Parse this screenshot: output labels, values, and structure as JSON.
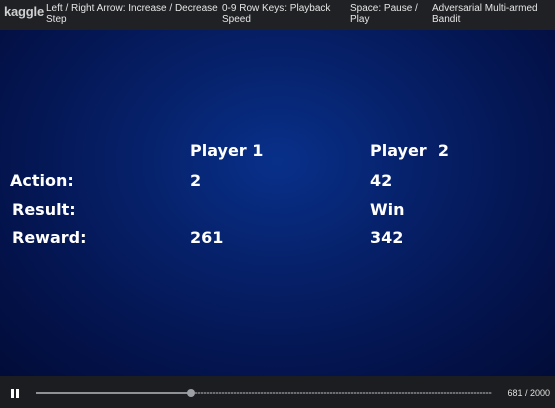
{
  "header": {
    "logo": "kaggle",
    "hints": [
      {
        "line1": "Left / Right Arrow: Increase / Decrease",
        "line2": "Step"
      },
      {
        "line1": "0-9 Row Keys: Playback",
        "line2": "Speed"
      },
      {
        "line1": "Space: Pause /",
        "line2": "Play"
      },
      {
        "line1": "Adversarial Multi-armed",
        "line2": "Bandit"
      }
    ]
  },
  "board": {
    "player1_header": "Player 1",
    "player2_header": "Player  2",
    "rows": [
      {
        "label": "Action:",
        "p1": "2",
        "p2": "42"
      },
      {
        "label": "Result:",
        "p1": "",
        "p2": "Win"
      },
      {
        "label": "Reward:",
        "p1": "261",
        "p2": "342"
      }
    ]
  },
  "playback": {
    "icon": "pause-icon",
    "current_step": 681,
    "total_steps": 2000,
    "counter_text": "681 / 2000"
  }
}
